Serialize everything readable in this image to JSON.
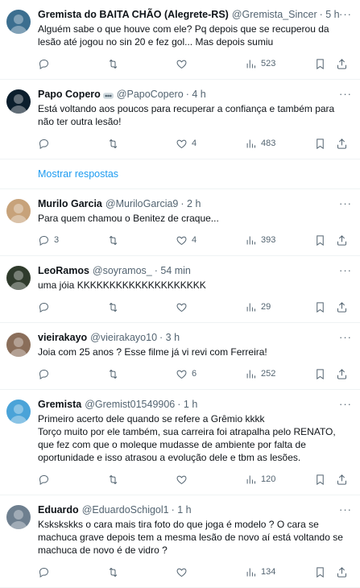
{
  "tweets": [
    {
      "name": "Gremista do BAITA CHÃO (Alegrete-RS)",
      "handle": "@Gremista_Sincer",
      "time": "· 5 h",
      "text": "Alguém sabe o que houve com ele? Pq depois que se recuperou da lesão até jogou no sin 20 e fez gol... Mas depois sumiu",
      "replies": "",
      "retweets": "",
      "likes": "",
      "views": "523",
      "avatar_color": "#3b6e8f"
    },
    {
      "name": "Papo Copero",
      "handle": "@PapoCopero",
      "time": "· 4 h",
      "text": "Está voltando aos poucos para recuperar a confiança e também para não ter outra lesão!",
      "replies": "",
      "retweets": "",
      "likes": "4",
      "views": "483",
      "avatar_color": "#0b1e2d",
      "verified": true
    },
    {
      "name": "Murilo Garcia",
      "handle": "@MuriloGarcia9",
      "time": "· 2 h",
      "text": "Para quem chamou o Benitez de craque...",
      "replies": "3",
      "retweets": "",
      "likes": "4",
      "views": "393",
      "avatar_color": "#c7a27a"
    },
    {
      "name": "LeoRamos",
      "handle": "@soyramos_",
      "time": "· 54 min",
      "text": "uma jóia KKKKKKKKKKKKKKKKKKKK",
      "replies": "",
      "retweets": "",
      "likes": "",
      "views": "29",
      "avatar_color": "#2f3b2c"
    },
    {
      "name": "vieirakayo",
      "handle": "@vieirakayo10",
      "time": "· 3 h",
      "text": "Joia com 25 anos ? Esse filme já vi revi com Ferreira!",
      "replies": "",
      "retweets": "",
      "likes": "6",
      "views": "252",
      "avatar_color": "#8a6e5a"
    },
    {
      "name": "Gremista",
      "handle": "@Gremist01549906",
      "time": "· 1 h",
      "text": "Primeiro acerto dele quando se refere a Grêmio kkkk\nTorço muito por ele também, sua carreira foi atrapalha pelo RENATO, que fez com que o moleque mudasse de ambiente por falta de oportunidade e isso atrasou a evolução dele e tbm as lesões.",
      "replies": "",
      "retweets": "",
      "likes": "",
      "views": "120",
      "avatar_color": "#4aa3d8"
    },
    {
      "name": "Eduardo",
      "handle": "@EduardoSchigol1",
      "time": "· 1 h",
      "text": "Kskskskks o cara mais tira foto do que joga é modelo ? O cara se machuca grave depois tem a mesma lesão de novo aí está voltando se machuca de novo é de vidro ?",
      "replies": "",
      "retweets": "",
      "likes": "",
      "views": "134",
      "avatar_color": "#6e7f8f"
    }
  ],
  "show_replies_label": "Mostrar respostas",
  "icons": {
    "reply": "reply-icon",
    "retweet": "retweet-icon",
    "like": "heart-icon",
    "views": "views-icon",
    "bookmark": "bookmark-icon",
    "share": "share-icon",
    "more": "more-icon"
  }
}
